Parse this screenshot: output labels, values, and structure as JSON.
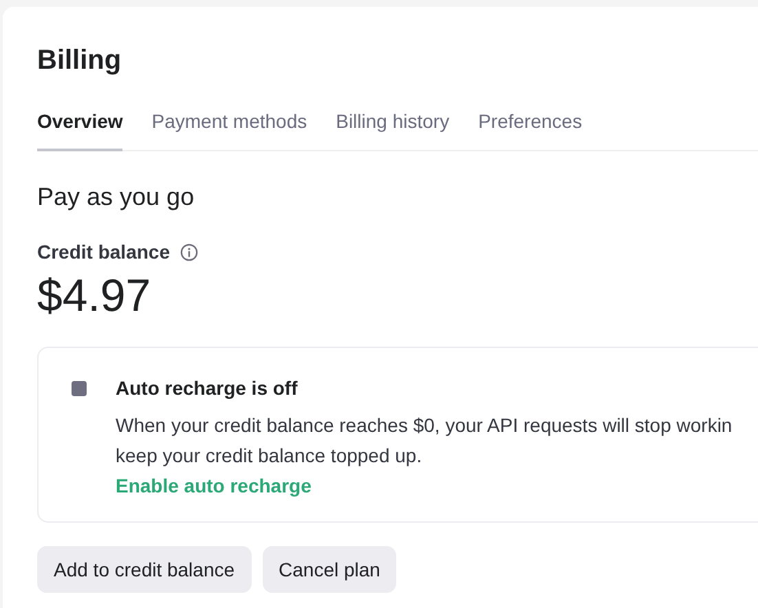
{
  "title": "Billing",
  "tabs": [
    {
      "label": "Overview",
      "selected": true
    },
    {
      "label": "Payment methods",
      "selected": false
    },
    {
      "label": "Billing history",
      "selected": false
    },
    {
      "label": "Preferences",
      "selected": false
    }
  ],
  "plan": "Pay as you go",
  "credit_balance": {
    "label": "Credit balance",
    "amount": "$4.97"
  },
  "auto_recharge": {
    "on": false,
    "title": "Auto recharge is off",
    "lines": [
      "When your credit balance reaches $0, your API requests will stop workin",
      "keep your credit balance topped up."
    ],
    "link": "Enable auto recharge"
  },
  "buttons": [
    "Add to credit balance",
    "Cancel plan"
  ]
}
